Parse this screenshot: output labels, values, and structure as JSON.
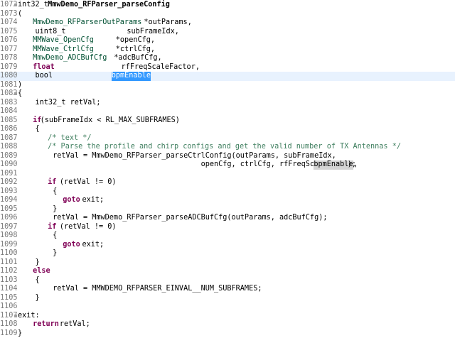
{
  "lines": [
    {
      "n": "1072",
      "hl": false,
      "t": [
        [
          "int32_t ",
          ""
        ],
        [
          "MmwDemo_RFParser_parseConfig",
          "fn"
        ]
      ]
    },
    {
      "n": "1073",
      "hl": false,
      "t": [
        [
          "(",
          ""
        ]
      ]
    },
    {
      "n": "1074",
      "hl": false,
      "t": [
        [
          "    ",
          ""
        ],
        [
          "MmwDemo_RFParserOutParams",
          "ty"
        ],
        [
          "    *outParams,",
          ""
        ]
      ]
    },
    {
      "n": "1075",
      "hl": false,
      "t": [
        [
          "    uint8_t              subFrameIdx,",
          ""
        ]
      ]
    },
    {
      "n": "1076",
      "hl": false,
      "t": [
        [
          "    ",
          ""
        ],
        [
          "MMWave_OpenCfg",
          "ty"
        ],
        [
          "       *openCfg,",
          ""
        ]
      ]
    },
    {
      "n": "1077",
      "hl": false,
      "t": [
        [
          "    ",
          ""
        ],
        [
          "MMWave_CtrlCfg",
          "ty"
        ],
        [
          "       *ctrlCfg,",
          ""
        ]
      ]
    },
    {
      "n": "1078",
      "hl": false,
      "t": [
        [
          "    ",
          ""
        ],
        [
          "MmwDemo_ADCBufCfg",
          "ty"
        ],
        [
          "    *adcBufCfg,",
          ""
        ]
      ]
    },
    {
      "n": "1079",
      "hl": false,
      "t": [
        [
          "    ",
          ""
        ],
        [
          "float",
          "kw"
        ],
        [
          "                rfFreqScaleFactor,",
          ""
        ]
      ]
    },
    {
      "n": "1080",
      "hl": true,
      "t": [
        [
          "    bool                 ",
          ""
        ],
        [
          "bpmEnable",
          "sel"
        ]
      ]
    },
    {
      "n": "1081",
      "hl": false,
      "t": [
        [
          ")",
          ""
        ]
      ]
    },
    {
      "n": "1082",
      "hl": false,
      "t": [
        [
          "{",
          ""
        ]
      ]
    },
    {
      "n": "1083",
      "hl": false,
      "t": [
        [
          "    int32_t retVal;",
          ""
        ]
      ]
    },
    {
      "n": "1084",
      "hl": false,
      "t": []
    },
    {
      "n": "1085",
      "hl": false,
      "t": [
        [
          "    ",
          ""
        ],
        [
          "if",
          "kw"
        ],
        [
          "(subFrameIdx < RL_MAX_SUBFRAMES)",
          ""
        ]
      ]
    },
    {
      "n": "1086",
      "hl": false,
      "t": [
        [
          "    {",
          ""
        ]
      ]
    },
    {
      "n": "1087",
      "hl": false,
      "t": [
        [
          "        ",
          ""
        ],
        [
          "/* text */",
          "cm"
        ]
      ]
    },
    {
      "n": "1088",
      "hl": false,
      "t": [
        [
          "        ",
          ""
        ],
        [
          "/* Parse the profile and chirp configs and get the valid number of TX Antennas */",
          "cm"
        ]
      ]
    },
    {
      "n": "1089",
      "hl": false,
      "t": [
        [
          "        retVal = MmwDemo_RFParser_parseCtrlConfig(outParams, subFrameIdx,",
          ""
        ]
      ]
    },
    {
      "n": "1090",
      "hl": false,
      "t": [
        [
          "                                          openCfg, ctrlCfg, rfFreqScaleFactor, ",
          ""
        ],
        [
          "bpmEnable",
          "occ"
        ],
        [
          ");",
          ""
        ]
      ]
    },
    {
      "n": "1091",
      "hl": false,
      "t": []
    },
    {
      "n": "1092",
      "hl": false,
      "t": [
        [
          "        ",
          ""
        ],
        [
          "if",
          "kw"
        ],
        [
          " (retVal != 0)",
          ""
        ]
      ]
    },
    {
      "n": "1093",
      "hl": false,
      "t": [
        [
          "        {",
          ""
        ]
      ]
    },
    {
      "n": "1094",
      "hl": false,
      "t": [
        [
          "            ",
          ""
        ],
        [
          "goto",
          "kw"
        ],
        [
          " exit;",
          ""
        ]
      ]
    },
    {
      "n": "1095",
      "hl": false,
      "t": [
        [
          "        }",
          ""
        ]
      ]
    },
    {
      "n": "1096",
      "hl": false,
      "t": [
        [
          "        retVal = MmwDemo_RFParser_parseADCBufCfg(outParams, adcBufCfg);",
          ""
        ]
      ]
    },
    {
      "n": "1097",
      "hl": false,
      "t": [
        [
          "        ",
          ""
        ],
        [
          "if",
          "kw"
        ],
        [
          " (retVal != 0)",
          ""
        ]
      ]
    },
    {
      "n": "1098",
      "hl": false,
      "t": [
        [
          "        {",
          ""
        ]
      ]
    },
    {
      "n": "1099",
      "hl": false,
      "t": [
        [
          "            ",
          ""
        ],
        [
          "goto",
          "kw"
        ],
        [
          " exit;",
          ""
        ]
      ]
    },
    {
      "n": "1100",
      "hl": false,
      "t": [
        [
          "        }",
          ""
        ]
      ]
    },
    {
      "n": "1101",
      "hl": false,
      "t": [
        [
          "    }",
          ""
        ]
      ]
    },
    {
      "n": "1102",
      "hl": false,
      "t": [
        [
          "    ",
          ""
        ],
        [
          "else",
          "kw"
        ]
      ]
    },
    {
      "n": "1103",
      "hl": false,
      "t": [
        [
          "    {",
          ""
        ]
      ]
    },
    {
      "n": "1104",
      "hl": false,
      "t": [
        [
          "        retVal = MMWDEMO_RFPARSER_EINVAL__NUM_SUBFRAMES;",
          ""
        ]
      ]
    },
    {
      "n": "1105",
      "hl": false,
      "t": [
        [
          "    }",
          ""
        ]
      ]
    },
    {
      "n": "1106",
      "hl": false,
      "t": []
    },
    {
      "n": "1107",
      "hl": false,
      "t": [
        [
          "exit:",
          ""
        ]
      ]
    },
    {
      "n": "1108",
      "hl": false,
      "t": [
        [
          "    ",
          ""
        ],
        [
          "return",
          "kw"
        ],
        [
          " retVal;",
          ""
        ]
      ]
    },
    {
      "n": "1109",
      "hl": false,
      "t": [
        [
          "}",
          ""
        ]
      ]
    }
  ]
}
